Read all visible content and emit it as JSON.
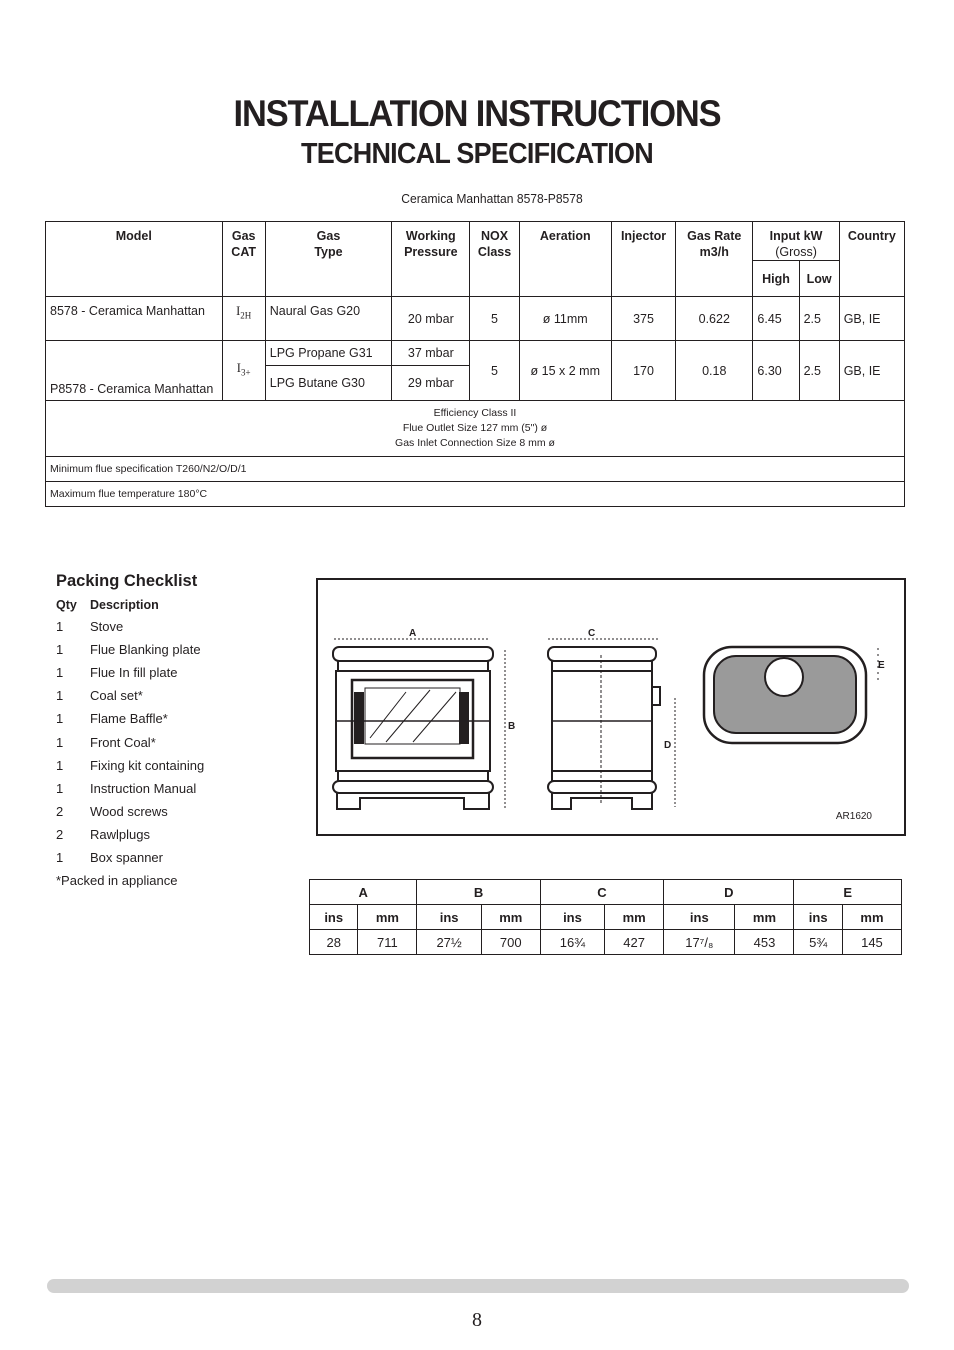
{
  "header": {
    "title": "INSTALLATION INSTRUCTIONS",
    "subtitle": "TECHNICAL SPECIFICATION",
    "caption": "Ceramica Manhattan 8578-P8578"
  },
  "spec_table": {
    "headers": {
      "model": "Model",
      "gas_cat_1": "Gas",
      "gas_cat_2": "CAT",
      "gas_type_1": "Gas",
      "gas_type_2": "Type",
      "pressure_1": "Working",
      "pressure_2": "Pressure",
      "nox_1": "NOX",
      "nox_2": "Class",
      "aeration": "Aeration",
      "injector": "Injector",
      "gas_rate_1": "Gas Rate",
      "gas_rate_2": "m3/h",
      "input_1": "Input kW",
      "input_2": "(Gross)",
      "high": "High",
      "low": "Low",
      "country": "Country"
    },
    "rows": [
      {
        "model": "8578 -  Ceramica Manhattan",
        "gas_cat": "I",
        "gas_cat_sub": "2H",
        "gas_type": "Naural Gas G20",
        "pressure": "20 mbar",
        "nox": "5",
        "aeration": "ø 11mm",
        "injector": "375",
        "gas_rate": "0.622",
        "high": "6.45",
        "low": "2.5",
        "country": "GB, IE"
      },
      {
        "model": "P8578 -  Ceramica Manhattan",
        "gas_cat": "I",
        "gas_cat_sub": "3+",
        "gas_type_a": "LPG Propane G31",
        "pressure_a": "37 mbar",
        "gas_type_b": "LPG Butane G30",
        "pressure_b": "29 mbar",
        "nox": "5",
        "aeration": "ø 15 x 2 mm",
        "injector": "170",
        "gas_rate": "0.18",
        "high": "6.30",
        "low": "2.5",
        "country": "GB, IE"
      }
    ],
    "notes": {
      "efficiency": "Efficiency Class II",
      "flue_outlet": "Flue Outlet Size 127 mm (5\") ø",
      "gas_inlet": "Gas Inlet Connection Size 8 mm ø",
      "min_flue": "Minimum flue specification T260/N2/O/D/1",
      "max_temp": "Maximum flue temperature 180°C"
    }
  },
  "packing": {
    "title": "Packing Checklist",
    "qty_header": "Qty",
    "desc_header": "Description",
    "items": [
      {
        "qty": "1",
        "desc": "Stove"
      },
      {
        "qty": "1",
        "desc": "Flue Blanking plate"
      },
      {
        "qty": "1",
        "desc": "Flue In fill plate"
      },
      {
        "qty": "1",
        "desc": "Coal set*"
      },
      {
        "qty": "1",
        "desc": "Flame Baffle*"
      },
      {
        "qty": "1",
        "desc": "Front Coal*"
      },
      {
        "qty": "1",
        "desc": "Fixing kit containing"
      },
      {
        "qty": "1",
        "desc": "Instruction Manual"
      },
      {
        "qty": "2",
        "desc": "Wood screws"
      },
      {
        "qty": "2",
        "desc": "Rawlplugs"
      },
      {
        "qty": "1",
        "desc": "Box spanner"
      }
    ],
    "note": "*Packed in appliance"
  },
  "diagram": {
    "labels": {
      "a": "A",
      "b": "B",
      "c": "C",
      "d": "D",
      "e": "E"
    },
    "reference": "AR1620"
  },
  "dimensions": {
    "groups": [
      "A",
      "B",
      "C",
      "D",
      "E"
    ],
    "unit_ins": "ins",
    "unit_mm": "mm",
    "values": [
      {
        "ins": "28",
        "mm": "711"
      },
      {
        "ins": "27½",
        "mm": "700"
      },
      {
        "ins": "16¾",
        "mm": "427"
      },
      {
        "ins": "17⁷/₈",
        "mm": "453"
      },
      {
        "ins": "5¾",
        "mm": "145"
      }
    ]
  },
  "footer": {
    "page_number": "8"
  }
}
